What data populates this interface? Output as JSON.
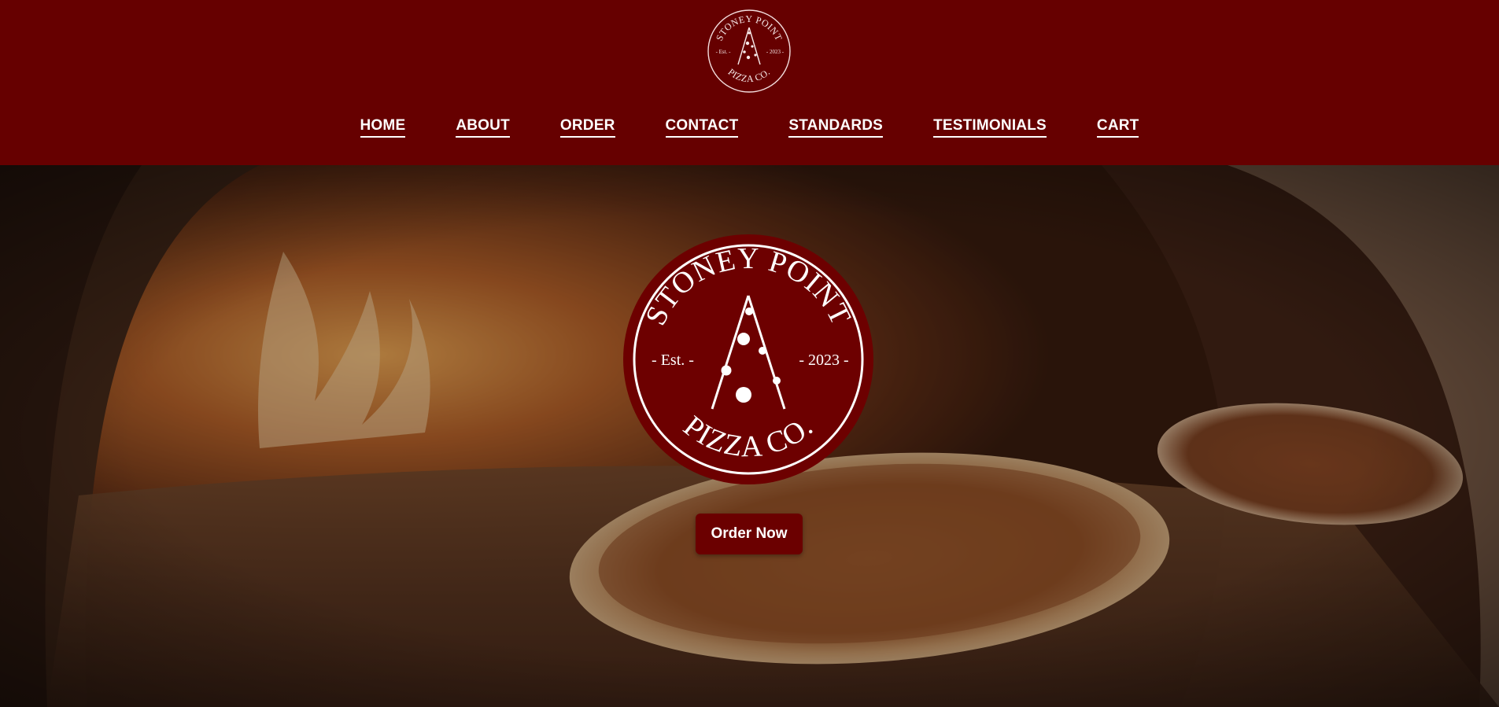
{
  "brand": {
    "name_top": "STONEY POINT",
    "name_bottom": "PIZZA CO.",
    "est_label": "- Est. -",
    "year_label": "- 2023 -"
  },
  "nav": {
    "items": [
      {
        "label": "HOME"
      },
      {
        "label": "ABOUT"
      },
      {
        "label": "ORDER"
      },
      {
        "label": "CONTACT"
      },
      {
        "label": "STANDARDS"
      },
      {
        "label": "TESTIMONIALS"
      },
      {
        "label": "CART"
      }
    ]
  },
  "hero": {
    "cta_label": "Order Now",
    "background_image": "pizza-oven-photo"
  },
  "colors": {
    "brand_red": "#660000",
    "text": "#ffffff"
  }
}
